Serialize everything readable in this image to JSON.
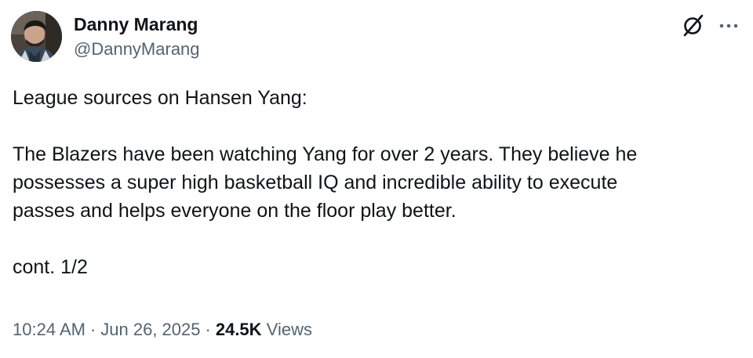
{
  "author": {
    "display_name": "Danny Marang",
    "handle": "@DannyMarang"
  },
  "icons": {
    "avatar": "profile-photo",
    "grok": "grok-icon",
    "more": "more-icon"
  },
  "tweet": {
    "paragraphs": [
      "League sources on Hansen Yang:",
      "The Blazers have been watching Yang for over 2 years. They believe he\npossesses a super high basketball IQ and incredible ability to execute\npasses and helps everyone on the floor play better.",
      "cont. 1/2"
    ]
  },
  "meta": {
    "time": "10:24 AM",
    "separator": "·",
    "date": "Jun 26, 2025",
    "views_count": "24.5K",
    "views_label": "Views"
  },
  "colors": {
    "text_primary": "#0f1419",
    "text_secondary": "#536471",
    "background": "#ffffff"
  }
}
